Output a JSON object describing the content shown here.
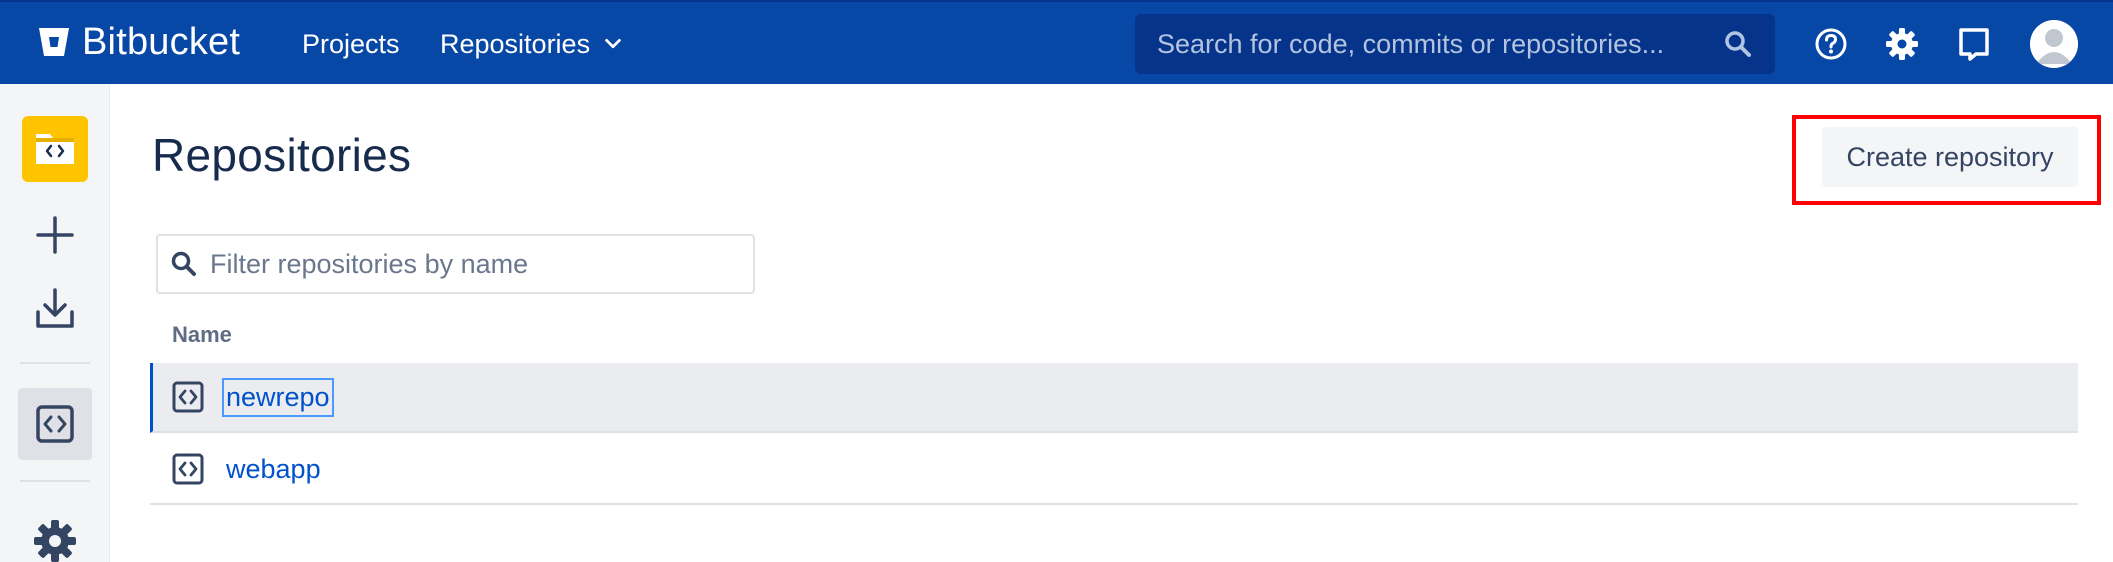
{
  "header": {
    "logo_text": "Bitbucket",
    "nav": {
      "projects": "Projects",
      "repositories": "Repositories"
    },
    "search_placeholder": "Search for code, commits or repositories...",
    "icons": [
      "bitbucket-logo-icon",
      "chevron-down-icon",
      "search-icon",
      "help-icon",
      "gear-icon",
      "notifications-icon",
      "avatar"
    ]
  },
  "sidebar": {
    "items": [
      "project-avatar",
      "create-icon",
      "clone-download-icon",
      "repository-code-icon",
      "settings-gear-icon"
    ]
  },
  "main": {
    "title": "Repositories",
    "create_button": "Create repository",
    "filter_placeholder": "Filter repositories by name",
    "table": {
      "column": "Name",
      "rows": [
        {
          "name": "newrepo",
          "selected": true
        },
        {
          "name": "webapp",
          "selected": false
        }
      ]
    }
  },
  "colors": {
    "header_bg": "#0747a6",
    "accent": "#0052cc",
    "project_badge": "#ffc400",
    "highlight": "#ff0000"
  }
}
